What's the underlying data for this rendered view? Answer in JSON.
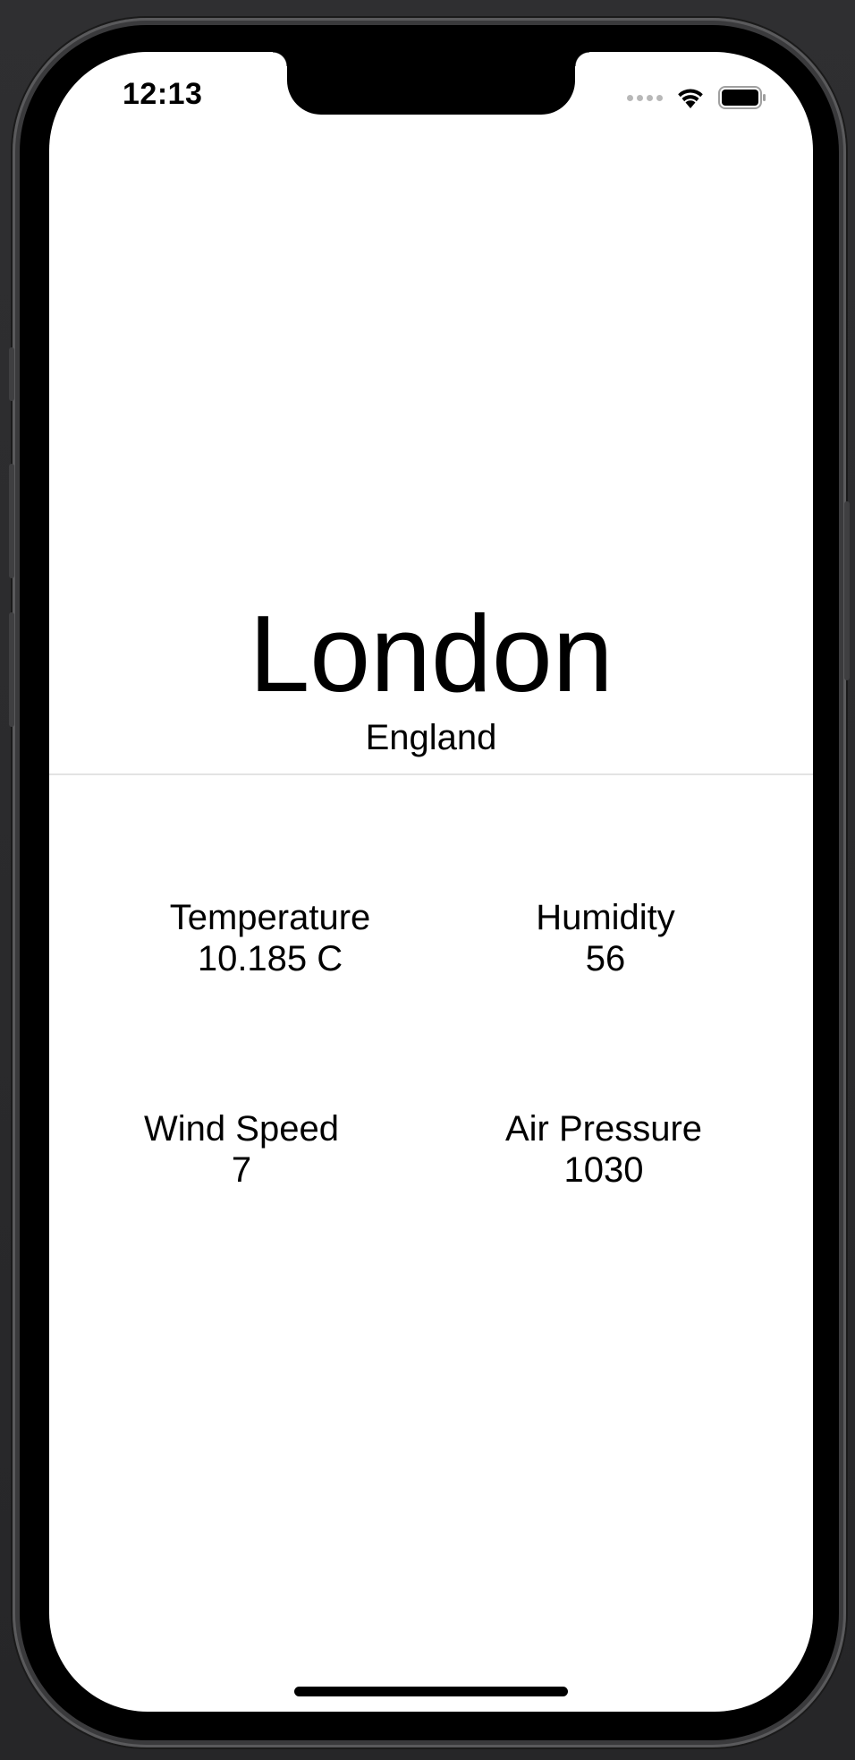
{
  "status_bar": {
    "time": "12:13",
    "icons": [
      "cellular-signal-icon",
      "wifi-icon",
      "battery-icon"
    ]
  },
  "location": {
    "city": "London",
    "country": "England"
  },
  "metrics": {
    "temperature": {
      "label": "Temperature",
      "value": "10.185 C"
    },
    "humidity": {
      "label": "Humidity",
      "value": "56"
    },
    "wind_speed": {
      "label": "Wind Speed",
      "value": "7"
    },
    "air_pressure": {
      "label": "Air Pressure",
      "value": "1030"
    }
  },
  "colors": {
    "background": "#ffffff",
    "text": "#000000",
    "divider": "#e3e3e3",
    "device_frame": "#000000"
  }
}
